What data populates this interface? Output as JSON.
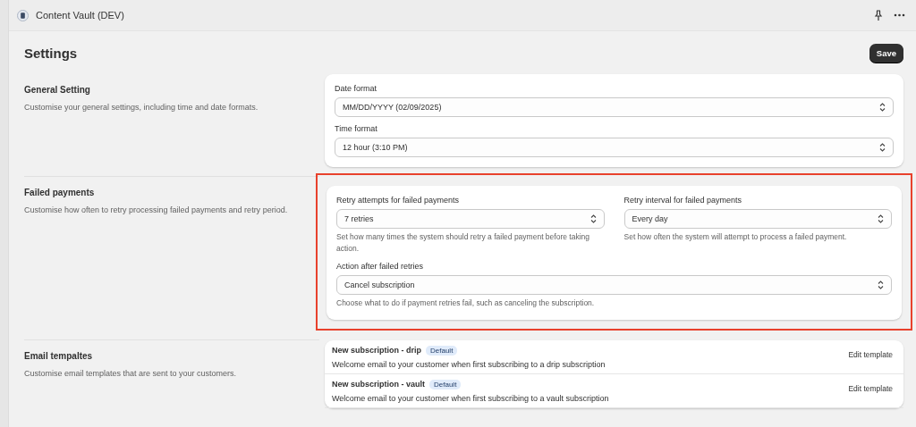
{
  "window": {
    "title": "Content Vault (DEV)"
  },
  "page": {
    "title": "Settings",
    "save_button": "Save"
  },
  "general": {
    "title": "General Setting",
    "description": "Customise your general settings, including time and date formats.",
    "fields": [
      {
        "label": "Date format",
        "value": "MM/DD/YYYY (02/09/2025)"
      },
      {
        "label": "Time format",
        "value": "12 hour (3:10 PM)"
      }
    ]
  },
  "failed_payments": {
    "title": "Failed payments",
    "description": "Customise how often to retry processing failed payments and retry period.",
    "highlighted": true,
    "rows": [
      [
        {
          "label": "Retry attempts for failed payments",
          "value": "7 retries",
          "help": "Set how many times the system should retry a failed payment before taking action."
        },
        {
          "label": "Retry interval for failed payments",
          "value": "Every day",
          "help": "Set how often the system will attempt to process a failed payment."
        }
      ],
      [
        {
          "label": "Action after failed retries",
          "value": "Cancel subscription",
          "help": "Choose what to do if payment retries fail, such as canceling the subscription."
        }
      ]
    ]
  },
  "email_templates": {
    "title": "Email tempaltes",
    "description": "Customise email templates that are sent to your customers.",
    "templates": [
      {
        "name": "New subscription - drip",
        "badge": "Default",
        "description": "Welcome email to your customer when first subscribing to a drip subscription",
        "action": "Edit template"
      },
      {
        "name": "New subscription - vault",
        "badge": "Default",
        "description": "Welcome email to your customer when first subscribing to a vault subscription",
        "action": "Edit template"
      }
    ]
  }
}
